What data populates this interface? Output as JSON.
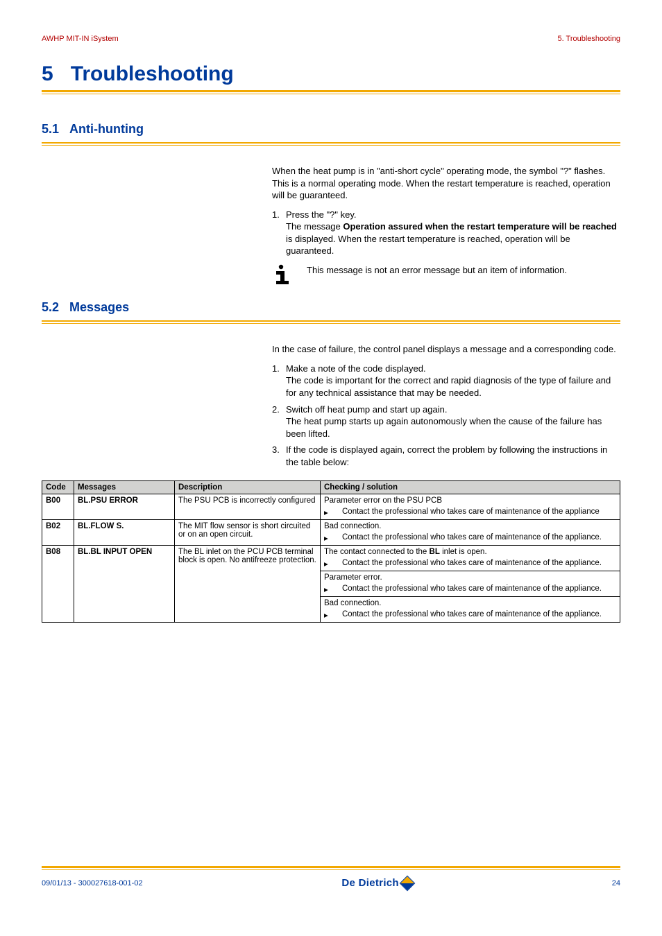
{
  "header": {
    "left": "AWHP MIT-IN iSystem",
    "right": "5.  Troubleshooting"
  },
  "chapter": {
    "num": "5",
    "title": "Troubleshooting"
  },
  "s1": {
    "num": "5.1",
    "title": "Anti-hunting",
    "para": "When the heat pump is in \"anti-short cycle\" operating mode, the symbol \"?\" flashes. This is a normal operating mode. When the restart temperature is reached, operation will be guaranteed.",
    "step1_num": "1.",
    "step1_lead": "Press the \"?\" key.",
    "step1_body_a": "The message ",
    "step1_body_bold": "Operation assured when the restart temperature will be reached",
    "step1_body_b": " is displayed. When the restart temperature is reached, operation will be guaranteed.",
    "info": "This message is not an error message but an item of information."
  },
  "s2": {
    "num": "5.2",
    "title": "Messages",
    "para": "In the case of failure, the control panel displays a message and a corresponding code.",
    "steps": [
      {
        "n": "1.",
        "lead": "Make a note of the code displayed.",
        "body": "The code is important for the correct and rapid diagnosis of the type of failure and for any technical assistance that may be needed."
      },
      {
        "n": "2.",
        "lead": "Switch off heat pump and start up again.",
        "body": "The heat pump starts up again autonomously when the cause of the failure has been lifted."
      },
      {
        "n": "3.",
        "lead": "If the code is displayed again, correct the problem by following the instructions in the table below:",
        "body": ""
      }
    ]
  },
  "table": {
    "headers": {
      "code": "Code",
      "msg": "Messages",
      "desc": "Description",
      "sol": "Checking / solution"
    },
    "bullet_symbol": "▸",
    "rows": [
      {
        "code": "B00",
        "msg": "BL.PSU ERROR",
        "desc": "The PSU PCB is incorrectly configured",
        "sols": [
          {
            "title": "Parameter error on the PSU PCB",
            "bullet": "Contact the professional who takes care of maintenance of the appliance"
          }
        ]
      },
      {
        "code": "B02",
        "msg": "BL.FLOW S.",
        "desc": "The MIT flow sensor is short circuited or on an open circuit.",
        "sols": [
          {
            "title": "Bad connection.",
            "bullet": "Contact the professional who takes care of maintenance of the appliance."
          }
        ]
      },
      {
        "code": "B08",
        "msg": "BL.BL INPUT OPEN",
        "desc": "The BL inlet on the PCU PCB terminal block is open. No antifreeze protection.",
        "sols": [
          {
            "title_a": "The contact connected to the ",
            "title_bold": "BL",
            "title_b": " inlet is open.",
            "bullet": "Contact the professional who takes care of maintenance of the appliance."
          },
          {
            "title": "Parameter error.",
            "bullet": "Contact the professional who takes care of maintenance of the appliance."
          },
          {
            "title": "Bad connection.",
            "bullet": "Contact the professional who takes care of maintenance of the appliance."
          }
        ]
      }
    ]
  },
  "footer": {
    "left": "09/01/13 - 300027618-001-02",
    "logo": "De Dietrich",
    "right": "24"
  }
}
